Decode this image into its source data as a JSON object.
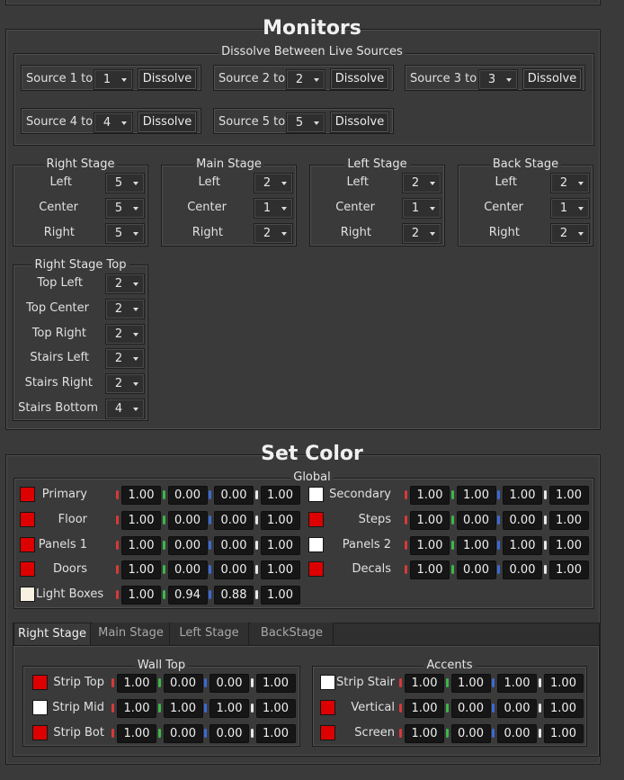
{
  "monitors": {
    "title": "Monitors",
    "dissolve_group": {
      "title": "Dissolve Between Live Sources",
      "sources": [
        {
          "label": "Source 1 to",
          "value": "1",
          "button": "Dissolve"
        },
        {
          "label": "Source 2 to",
          "value": "2",
          "button": "Dissolve"
        },
        {
          "label": "Source 3 to",
          "value": "3",
          "button": "Dissolve"
        },
        {
          "label": "Source 4 to",
          "value": "4",
          "button": "Dissolve"
        },
        {
          "label": "Source 5 to",
          "value": "5",
          "button": "Dissolve"
        }
      ]
    },
    "stages": [
      {
        "title": "Right Stage",
        "rows": [
          {
            "label": "Left",
            "value": "5"
          },
          {
            "label": "Center",
            "value": "5"
          },
          {
            "label": "Right",
            "value": "5"
          }
        ]
      },
      {
        "title": "Main Stage",
        "rows": [
          {
            "label": "Left",
            "value": "2"
          },
          {
            "label": "Center",
            "value": "1"
          },
          {
            "label": "Right",
            "value": "2"
          }
        ]
      },
      {
        "title": "Left Stage",
        "rows": [
          {
            "label": "Left",
            "value": "2"
          },
          {
            "label": "Center",
            "value": "1"
          },
          {
            "label": "Right",
            "value": "2"
          }
        ]
      },
      {
        "title": "Back Stage",
        "rows": [
          {
            "label": "Left",
            "value": "2"
          },
          {
            "label": "Center",
            "value": "1"
          },
          {
            "label": "Right",
            "value": "2"
          }
        ]
      }
    ],
    "right_stage_top": {
      "title": "Right Stage Top",
      "rows": [
        {
          "label": "Top Left",
          "value": "2"
        },
        {
          "label": "Top Center",
          "value": "2"
        },
        {
          "label": "Top Right",
          "value": "2"
        },
        {
          "label": "Stairs Left",
          "value": "2"
        },
        {
          "label": "Stairs Right",
          "value": "2"
        },
        {
          "label": "Stairs Bottom",
          "value": "4"
        }
      ]
    }
  },
  "set_color": {
    "title": "Set Color",
    "global": {
      "title": "Global",
      "left": [
        {
          "label": "Primary",
          "swatch": "#dd0000",
          "r": "1.00",
          "g": "0.00",
          "b": "0.00",
          "a": "1.00"
        },
        {
          "label": "Floor",
          "swatch": "#dd0000",
          "r": "1.00",
          "g": "0.00",
          "b": "0.00",
          "a": "1.00"
        },
        {
          "label": "Panels 1",
          "swatch": "#dd0000",
          "r": "1.00",
          "g": "0.00",
          "b": "0.00",
          "a": "1.00"
        },
        {
          "label": "Doors",
          "swatch": "#dd0000",
          "r": "1.00",
          "g": "0.00",
          "b": "0.00",
          "a": "1.00"
        },
        {
          "label": "Light Boxes",
          "swatch": "#f8f0e0",
          "r": "1.00",
          "g": "0.94",
          "b": "0.88",
          "a": "1.00"
        }
      ],
      "right": [
        {
          "label": "Secondary",
          "swatch": "#ffffff",
          "r": "1.00",
          "g": "1.00",
          "b": "1.00",
          "a": "1.00"
        },
        {
          "label": "Steps",
          "swatch": "#dd0000",
          "r": "1.00",
          "g": "0.00",
          "b": "0.00",
          "a": "1.00"
        },
        {
          "label": "Panels 2",
          "swatch": "#ffffff",
          "r": "1.00",
          "g": "1.00",
          "b": "1.00",
          "a": "1.00"
        },
        {
          "label": "Decals",
          "swatch": "#dd0000",
          "r": "1.00",
          "g": "0.00",
          "b": "0.00",
          "a": "1.00"
        }
      ]
    },
    "tabs": [
      "Right Stage",
      "Main Stage",
      "Left Stage",
      "BackStage"
    ],
    "wall_top": {
      "title": "Wall Top",
      "rows": [
        {
          "label": "Strip Top",
          "swatch": "#dd0000",
          "r": "1.00",
          "g": "0.00",
          "b": "0.00",
          "a": "1.00"
        },
        {
          "label": "Strip Mid",
          "swatch": "#ffffff",
          "r": "1.00",
          "g": "1.00",
          "b": "1.00",
          "a": "1.00"
        },
        {
          "label": "Strip Bot",
          "swatch": "#dd0000",
          "r": "1.00",
          "g": "0.00",
          "b": "0.00",
          "a": "1.00"
        }
      ]
    },
    "accents": {
      "title": "Accents",
      "rows": [
        {
          "label": "Strip Stair",
          "swatch": "#ffffff",
          "r": "1.00",
          "g": "1.00",
          "b": "1.00",
          "a": "1.00"
        },
        {
          "label": "Vertical",
          "swatch": "#dd0000",
          "r": "1.00",
          "g": "0.00",
          "b": "0.00",
          "a": "1.00"
        },
        {
          "label": "Screen",
          "swatch": "#dd0000",
          "r": "1.00",
          "g": "0.00",
          "b": "0.00",
          "a": "1.00"
        }
      ]
    }
  },
  "channel_colors": {
    "r": "#d63a3a",
    "g": "#3cb84a",
    "b": "#3a6ad6",
    "a": "#e8e8e8"
  }
}
